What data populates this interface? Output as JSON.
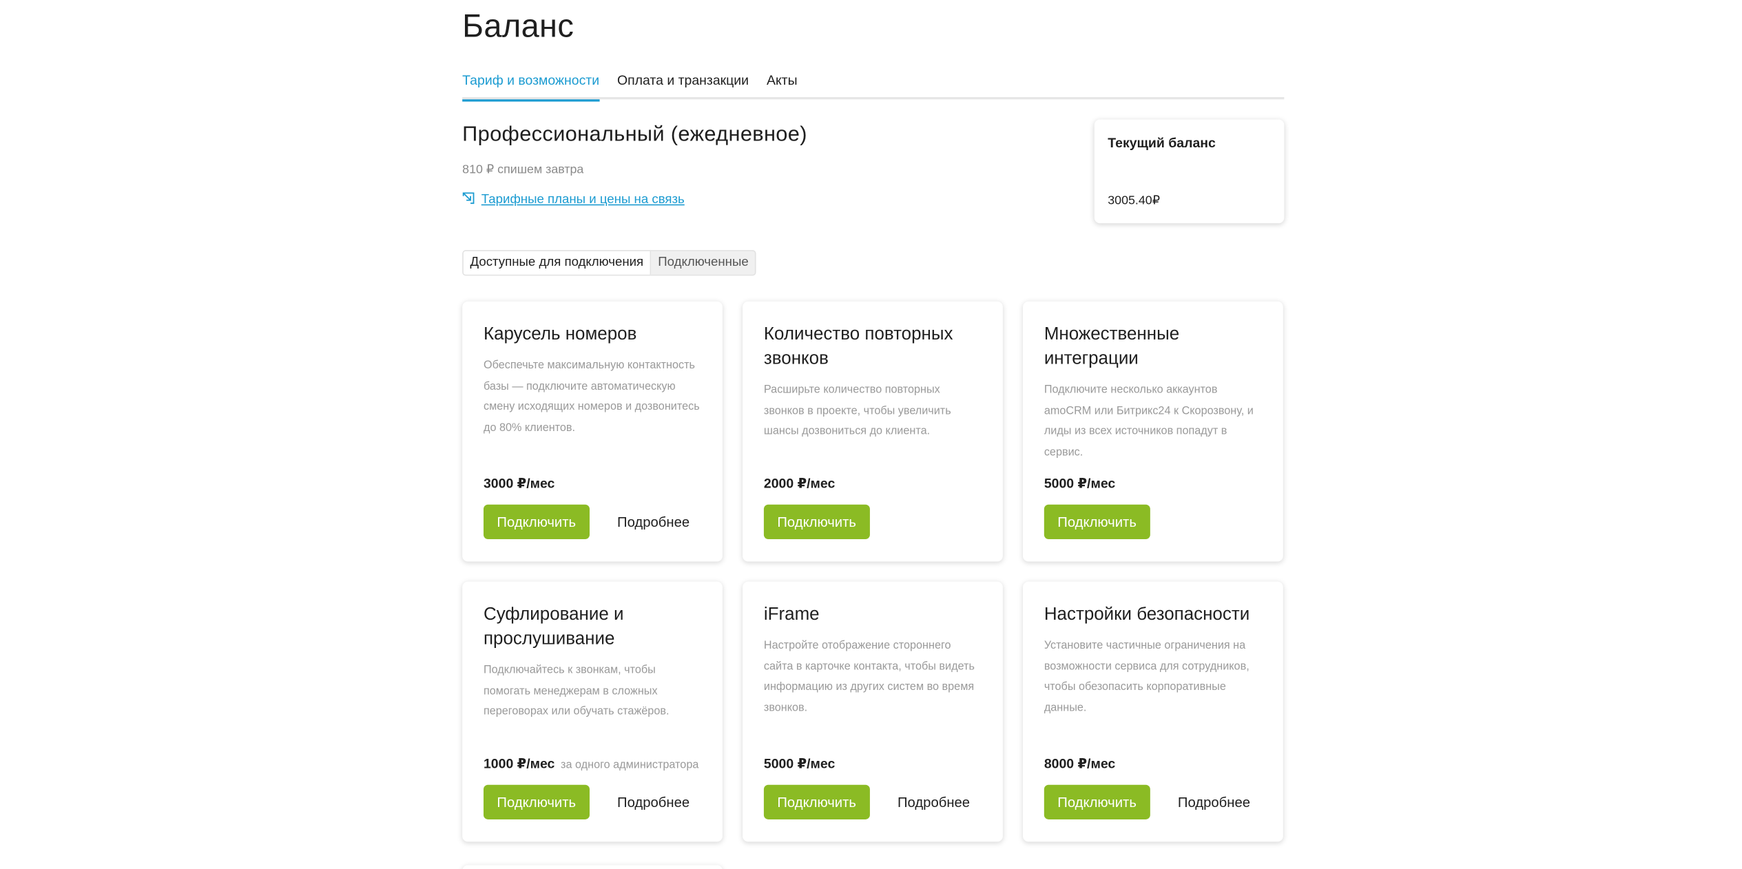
{
  "page": {
    "title": "Баланс"
  },
  "tabs": [
    {
      "label": "Тариф и возможности",
      "active": true
    },
    {
      "label": "Оплата и транзакции",
      "active": false
    },
    {
      "label": "Акты",
      "active": false
    }
  ],
  "plan": {
    "name": "Профессиональный (ежедневное)",
    "charge_note": "810 ₽ спишем завтра",
    "link_label": "Тарифные планы и цены на связь",
    "link_icon": "external-link-icon"
  },
  "balance": {
    "label": "Текущий баланс",
    "value": "3005.40₽"
  },
  "filter": {
    "options": [
      "Доступные для подключения",
      "Подключенные"
    ],
    "selected": "Доступные для подключения"
  },
  "colors": {
    "accent": "#1b9bd1",
    "button_green": "#8bbb24"
  },
  "cards": [
    {
      "title": "Карусель номеров",
      "description": "Обеспечьте максимальную контактность базы — подключите автоматическую смену исходящих номеров и дозвонитесь до 80% клиентов.",
      "price": "3000 ₽/мес",
      "price_note": "",
      "connect_label": "Подключить",
      "more_label": "Подробнее"
    },
    {
      "title": "Количество повторных звонков",
      "description": "Расширьте количество повторных звонков в проекте, чтобы увеличить шансы дозвониться до клиента.",
      "price": "2000 ₽/мес",
      "price_note": "",
      "connect_label": "Подключить",
      "more_label": ""
    },
    {
      "title": "Множественные интеграции",
      "description": "Подключите несколько аккаунтов amoCRM или Битрикс24 к Скорозвону, и лиды из всех источников попадут в сервис.",
      "price": "5000 ₽/мес",
      "price_note": "",
      "connect_label": "Подключить",
      "more_label": ""
    },
    {
      "title": "Суфлирование и прослушивание",
      "description": "Подключайтесь к звонкам, чтобы помогать менеджерам в сложных переговорах или обучать стажёров.",
      "price": "1000 ₽/мес",
      "price_note": "за одного администратора",
      "connect_label": "Подключить",
      "more_label": "Подробнее"
    },
    {
      "title": "iFrame",
      "description": "Настройте отображение стороннего сайта в карточке контакта, чтобы видеть информацию из других систем во время звонков.",
      "price": "5000 ₽/мес",
      "price_note": "",
      "connect_label": "Подключить",
      "more_label": "Подробнее"
    },
    {
      "title": "Настройки безопасности",
      "description": "Установите частичные ограничения на возможности сервиса для сотрудников, чтобы обезопасить корпоративные данные.",
      "price": "8000 ₽/мес",
      "price_note": "",
      "connect_label": "Подключить",
      "more_label": "Подробнее"
    }
  ]
}
